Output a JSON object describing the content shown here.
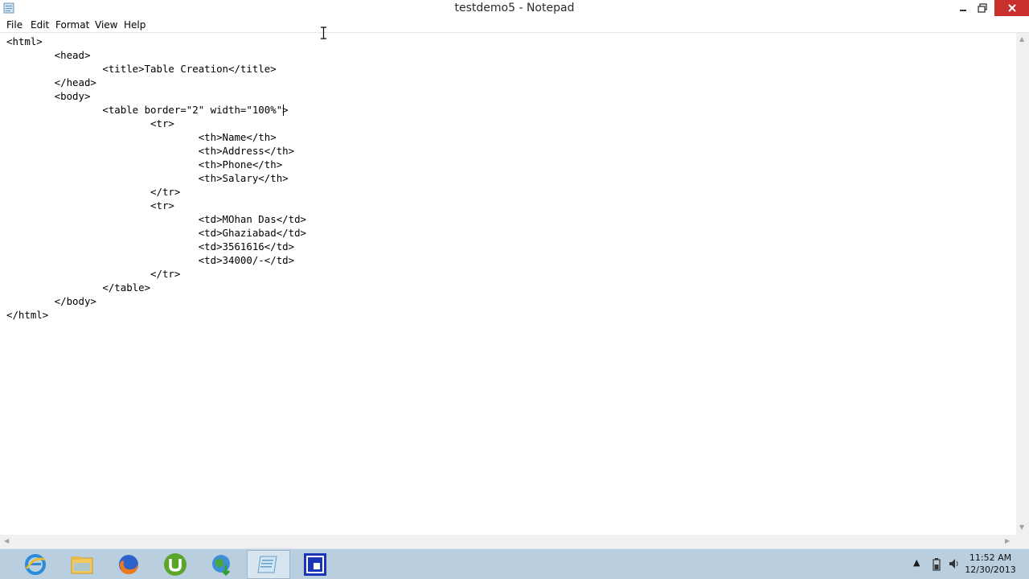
{
  "window": {
    "title": "testdemo5 - Notepad",
    "close_color": "#c7302b"
  },
  "menu": {
    "items": [
      "File",
      "Edit",
      "Format",
      "View",
      "Help"
    ]
  },
  "editor": {
    "lines": [
      "<html>",
      "        <head>",
      "                <title>Table Creation</title>",
      "        </head>",
      "        <body>",
      "                <table border=\"2\" width=\"100%\">",
      "                        <tr>",
      "                                <th>Name</th>",
      "                                <th>Address</th>",
      "                                <th>Phone</th>",
      "                                <th>Salary</th>",
      "                        </tr>",
      "                        <tr>",
      "                                <td>MOhan Das</td>",
      "                                <td>Ghaziabad</td>",
      "                                <td>3561616</td>",
      "                                <td>34000/-</td>",
      "                        </tr>",
      "                </table>",
      "        </body>",
      "</html>"
    ]
  },
  "taskbar": {
    "apps": [
      {
        "name": "internet-explorer"
      },
      {
        "name": "file-explorer"
      },
      {
        "name": "firefox"
      },
      {
        "name": "utorrent"
      },
      {
        "name": "internet-download-manager"
      },
      {
        "name": "notepad"
      },
      {
        "name": "remote-desktop"
      }
    ],
    "clock_time": "11:52 AM",
    "clock_date": "12/30/2013"
  }
}
